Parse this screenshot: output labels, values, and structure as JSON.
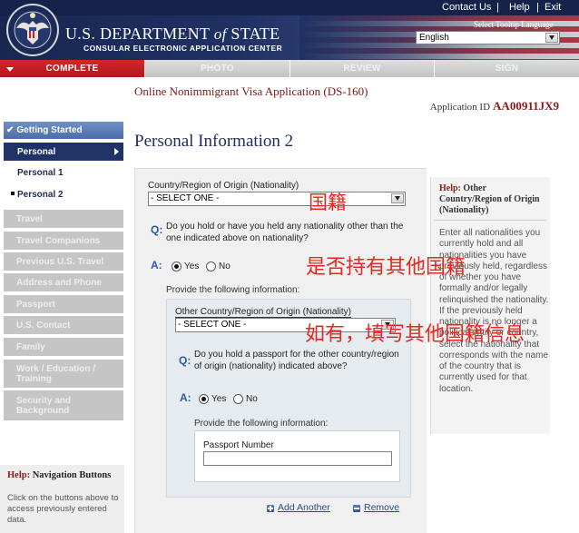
{
  "top_links": {
    "contact": "Contact Us",
    "help": "Help",
    "exit": "Exit",
    "separator": "|"
  },
  "header": {
    "title_main": "U.S. DEPARTMENT",
    "title_of": "of",
    "title_state": "STATE",
    "subtitle": "CONSULAR ELECTRONIC APPLICATION CENTER",
    "tooltip_label": "Select Tooltip Language",
    "language": "English",
    "seal_icon": "state-department-seal-icon"
  },
  "tabs": [
    {
      "label": "COMPLETE",
      "active": true
    },
    {
      "label": "PHOTO",
      "active": false
    },
    {
      "label": "REVIEW",
      "active": false
    },
    {
      "label": "SIGN",
      "active": false
    }
  ],
  "page": {
    "application_title": "Online Nonimmigrant Visa Application (DS-160)",
    "application_id_label": "Application ID",
    "application_id": "AA00911JX9",
    "page_title": "Personal Information 2"
  },
  "sidebar": {
    "getting_started": "Getting Started",
    "personal": "Personal",
    "sub": [
      "Personal 1",
      "Personal 2"
    ],
    "current": "Personal 2",
    "items": [
      "Travel",
      "Travel Companions",
      "Previous U.S. Travel",
      "Address and Phone",
      "Passport",
      "U.S. Contact",
      "Family",
      "Work / Education / Training",
      "Security and Background"
    ]
  },
  "help_nav": {
    "label": "Help:",
    "title": "Navigation Buttons",
    "body": "Click on the buttons above to access previously entered data."
  },
  "form": {
    "nationality_label": "Country/Region of Origin (Nationality)",
    "nationality_value": "- SELECT ONE -",
    "q_marker": "Q:",
    "a_marker": "A:",
    "q1": {
      "text": "Do you hold or have you held any nationality other than the one indicated above on nationality?",
      "yes": "Yes",
      "no": "No",
      "selected": "Yes"
    },
    "provide_label": "Provide the following information:",
    "other_label": "Other Country/Region of Origin (Nationality)",
    "other_value": "- SELECT ONE -",
    "q2": {
      "text": "Do you hold a passport for the other country/region of origin (nationality) indicated above?",
      "yes": "Yes",
      "no": "No",
      "selected": "Yes"
    },
    "provide_label_2": "Provide the following information:",
    "passport_label": "Passport Number",
    "passport_value": "",
    "add_another": "Add Another",
    "remove": "Remove"
  },
  "help_panel": {
    "label": "Help:",
    "title": "Other Country/Region of Origin (Nationality)",
    "body": "Enter all nationalities you currently hold and all nationalities you have previously held, regardless of whether you have formally and/or legally relinquished the nationality. If the previously held nationality is no longer a political entity or country, select the nationality that corresponds with the name of the country that is currently used for that location."
  },
  "annotations": [
    "国籍",
    "是否持有其他国籍",
    "如有，填写其他国籍信息"
  ],
  "colors": {
    "accent": "#c4161c",
    "navy": "#1f3366",
    "link": "#2a4c8f",
    "annotation": "#e8261f",
    "help_title": "#8b1a1a"
  }
}
